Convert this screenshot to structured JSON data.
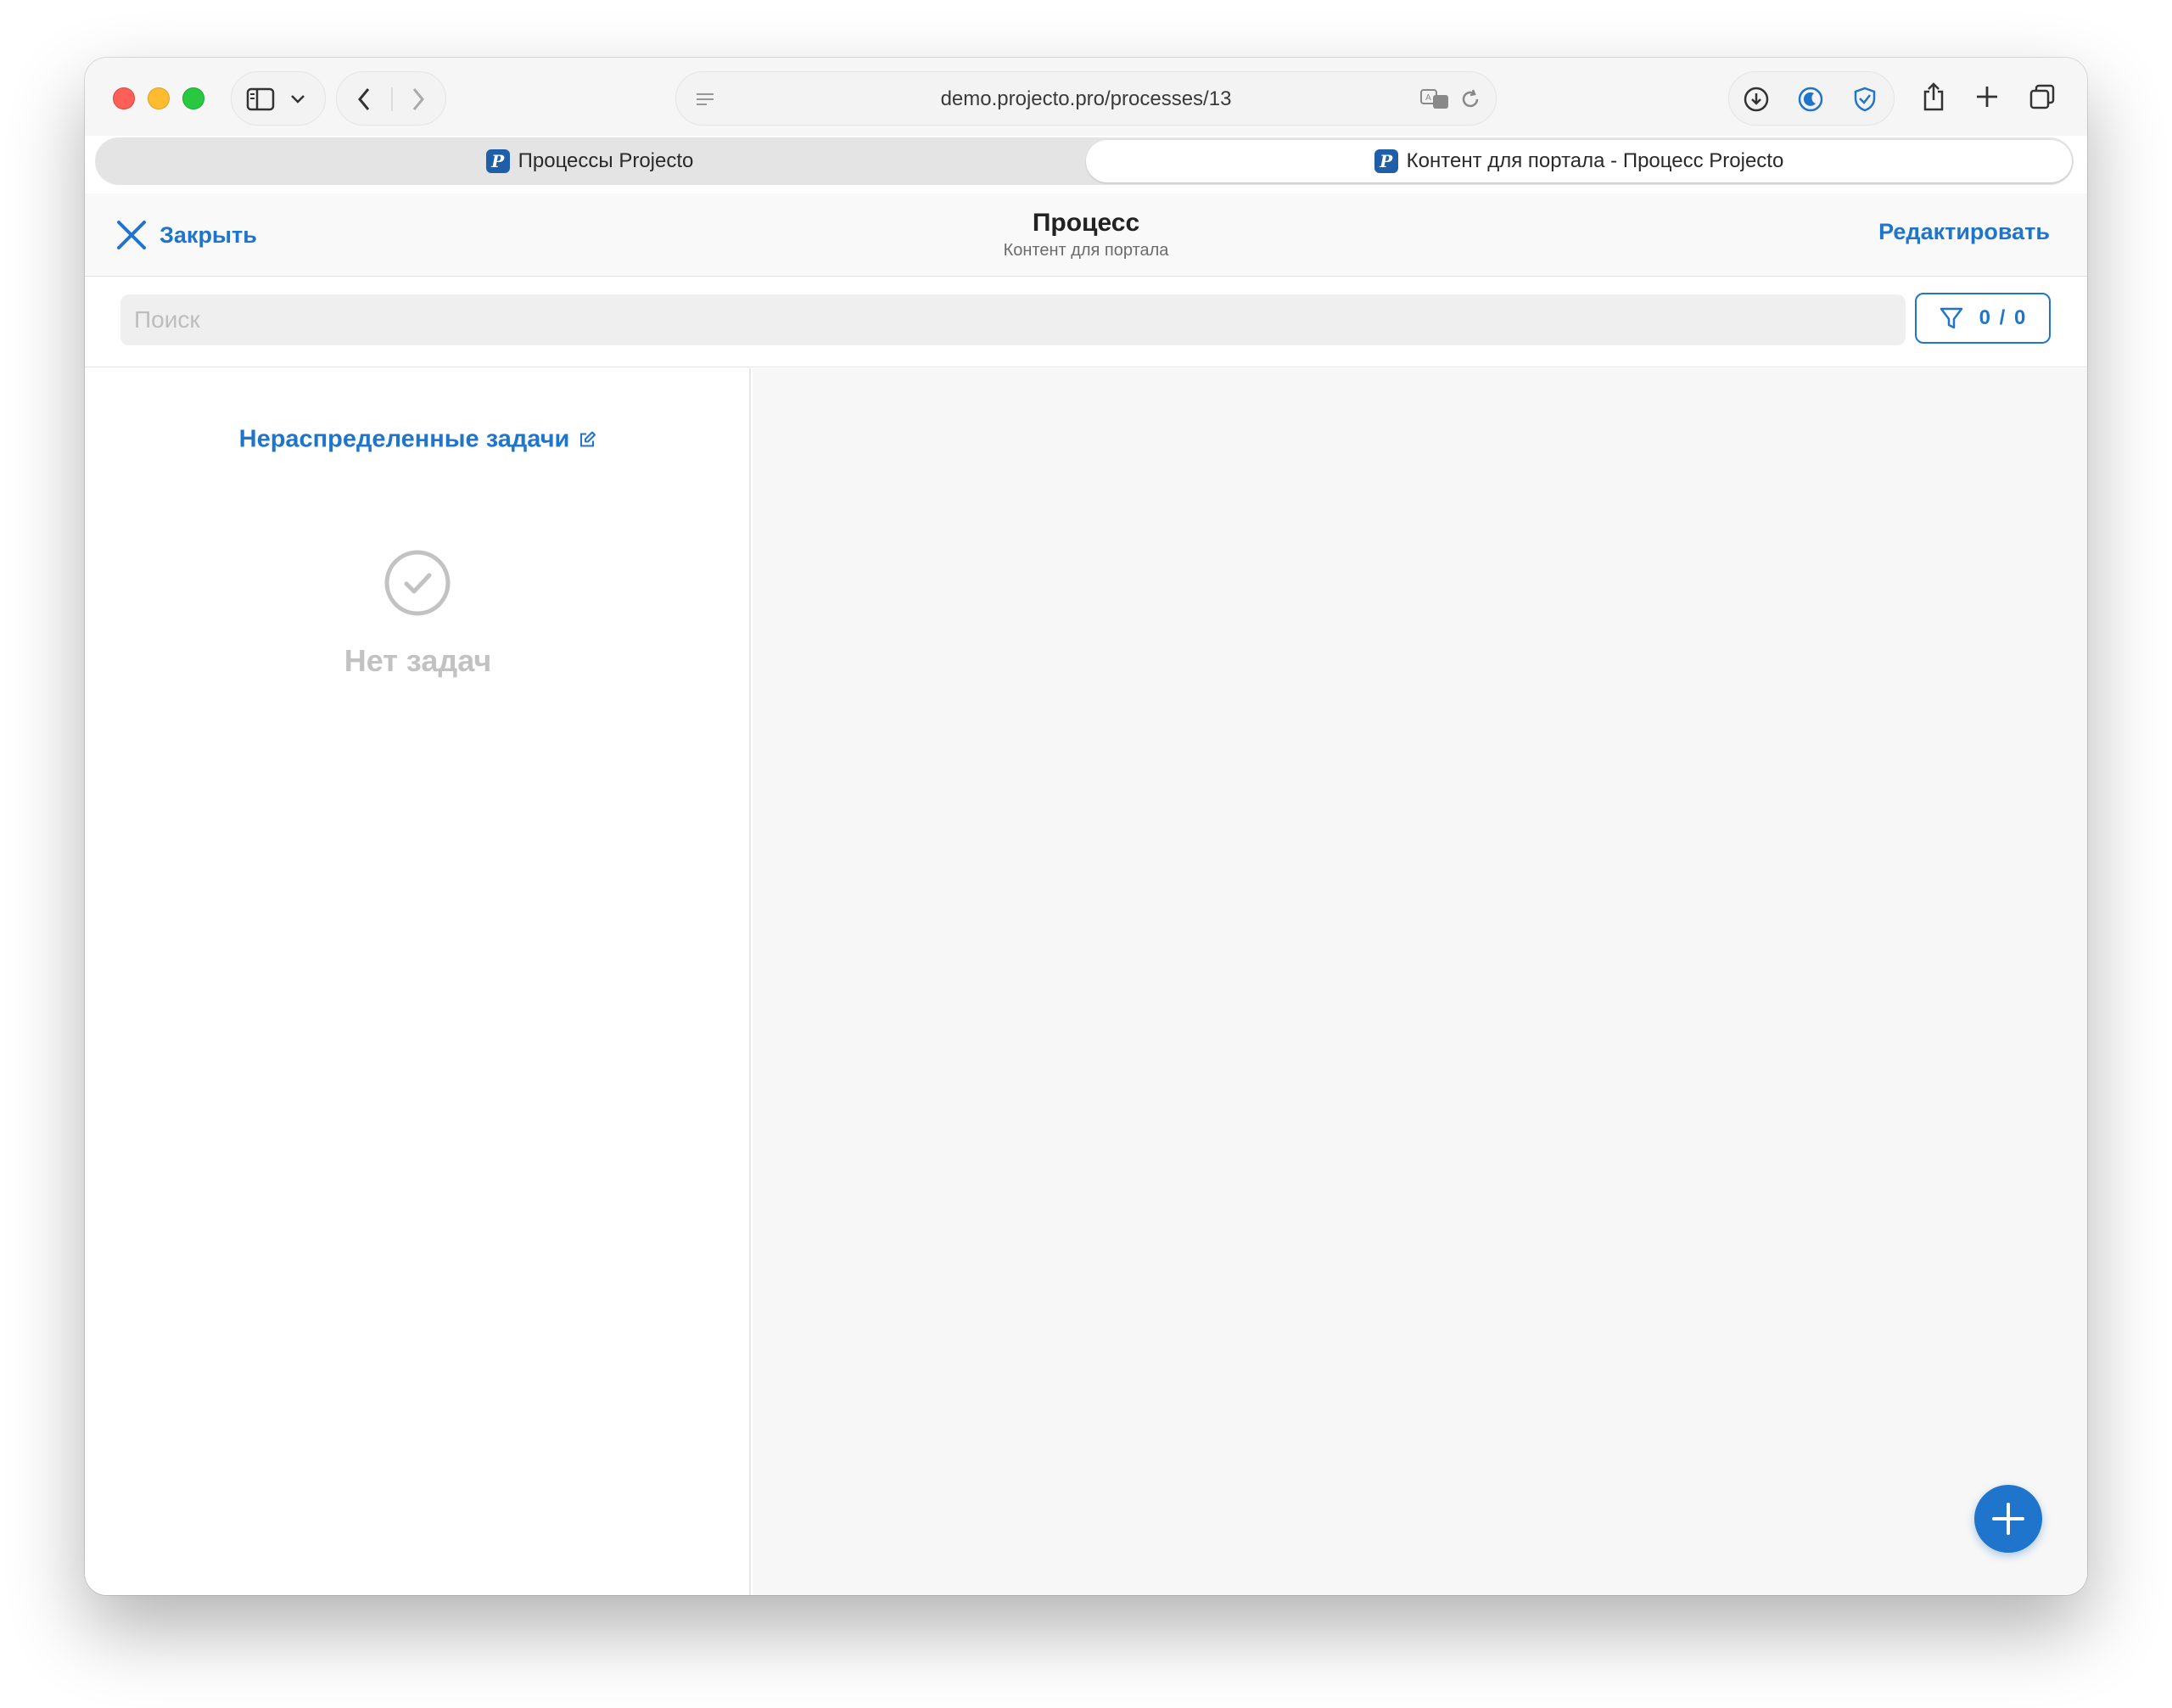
{
  "browser": {
    "url": "demo.projecto.pro/processes/13",
    "tabs": [
      {
        "label": "Процессы Projecto",
        "favicon": "P",
        "active": false
      },
      {
        "label": "Контент для портала - Процесс Projecto",
        "favicon": "P",
        "active": true
      }
    ]
  },
  "header": {
    "close_label": "Закрыть",
    "title": "Процесс",
    "subtitle": "Контент для портала",
    "edit_label": "Редактировать"
  },
  "search": {
    "placeholder": "Поиск",
    "value": "",
    "filter_count": "0 / 0"
  },
  "panel": {
    "title": "Нераспределенные задачи",
    "empty_text": "Нет задач"
  },
  "colors": {
    "accent": "#1f75cb",
    "empty_gray": "#c2c2c2"
  },
  "icons": {
    "close": "close-icon",
    "filter": "filter-icon",
    "edit": "edit-icon",
    "empty": "check-circle-icon",
    "fab": "plus-icon"
  }
}
